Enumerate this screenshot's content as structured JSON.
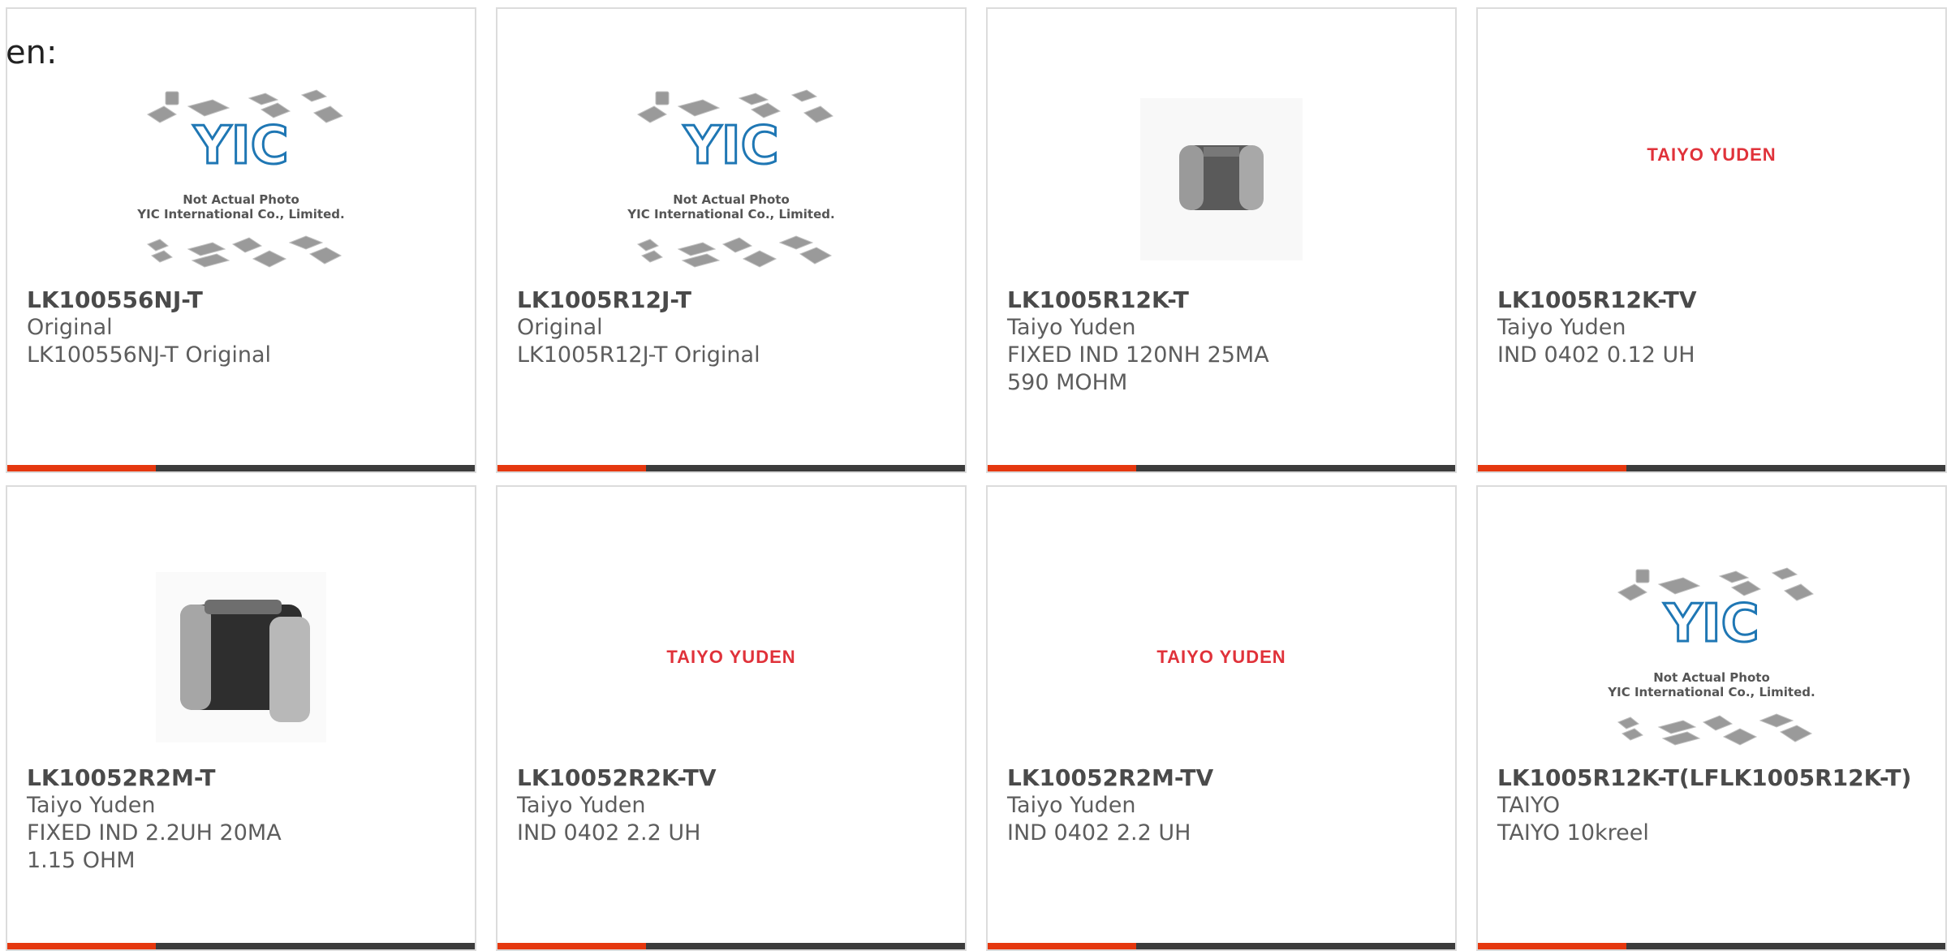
{
  "page": {
    "lang_label": "en:"
  },
  "colors": {
    "accent": "#e5380f",
    "bar": "#3c3c3c",
    "logo_red": "#e0323a",
    "yic_blue": "#1f77b4"
  },
  "placeholder": {
    "line1": "Not Actual Photo",
    "line2": "YIC International Co., Limited.",
    "logo": "YIC"
  },
  "products": [
    {
      "part": "LK100556NJ-T",
      "maker": "Original",
      "desc": "LK100556NJ-T Original",
      "image": "yic-placeholder"
    },
    {
      "part": "LK1005R12J-T",
      "maker": "Original",
      "desc": "LK1005R12J-T Original",
      "image": "yic-placeholder"
    },
    {
      "part": "LK1005R12K-T",
      "maker": "Taiyo Yuden",
      "desc": "FIXED IND 120NH 25MA 590 MOHM",
      "image": "small-inductor"
    },
    {
      "part": "LK1005R12K-TV",
      "maker": "Taiyo Yuden",
      "desc": "IND 0402 0.12 UH",
      "image": "taiyo-yuden-logo",
      "logo_text": "TAIYO YUDEN"
    },
    {
      "part": "LK10052R2M-T",
      "maker": "Taiyo Yuden",
      "desc": "FIXED IND 2.2UH 20MA 1.15 OHM",
      "image": "large-inductor"
    },
    {
      "part": "LK10052R2K-TV",
      "maker": "Taiyo Yuden",
      "desc": "IND 0402 2.2 UH",
      "image": "taiyo-yuden-logo",
      "logo_text": "TAIYO YUDEN"
    },
    {
      "part": "LK10052R2M-TV",
      "maker": "Taiyo Yuden",
      "desc": "IND 0402 2.2 UH",
      "image": "taiyo-yuden-logo",
      "logo_text": "TAIYO YUDEN"
    },
    {
      "part": "LK1005R12K-T(LFLK1005R12K-T)",
      "maker": "TAIYO",
      "desc": "TAIYO 10kreel",
      "image": "yic-placeholder"
    }
  ]
}
